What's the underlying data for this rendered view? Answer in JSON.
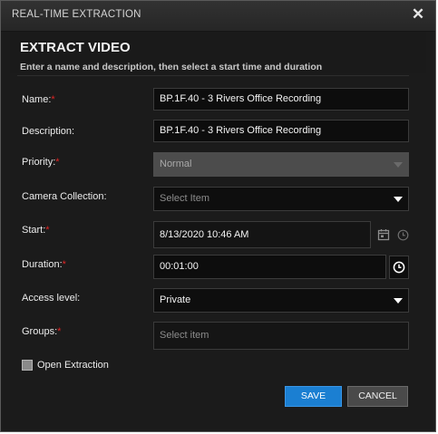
{
  "window": {
    "title": "REAL-TIME EXTRACTION"
  },
  "header": {
    "title": "EXTRACT VIDEO",
    "subtitle": "Enter a name and description, then select a start time and duration"
  },
  "form": {
    "name_label": "Name:",
    "name_value": "BP.1F.40 - 3 Rivers Office Recording",
    "description_label": "Description:",
    "description_value": "BP.1F.40 - 3 Rivers Office Recording",
    "priority_label": "Priority:",
    "priority_value": "Normal",
    "camera_label": "Camera Collection:",
    "camera_placeholder": "Select Item",
    "start_label": "Start:",
    "start_value": "8/13/2020 10:46 AM",
    "duration_label": "Duration:",
    "duration_value": "00:01:00",
    "access_label": "Access level:",
    "access_value": "Private",
    "groups_label": "Groups:",
    "groups_placeholder": "Select item",
    "required_mark": "*",
    "open_extraction_label": "Open Extraction",
    "open_extraction_checked": false
  },
  "buttons": {
    "save": "SAVE",
    "cancel": "CANCEL"
  },
  "icons": {
    "close": "close-icon",
    "calendar": "calendar-icon",
    "clock": "clock-icon",
    "dropdown": "chevron-down-icon"
  },
  "colors": {
    "primary": "#1b7fd2",
    "required": "#e02424",
    "background": "#1b1b1b"
  }
}
